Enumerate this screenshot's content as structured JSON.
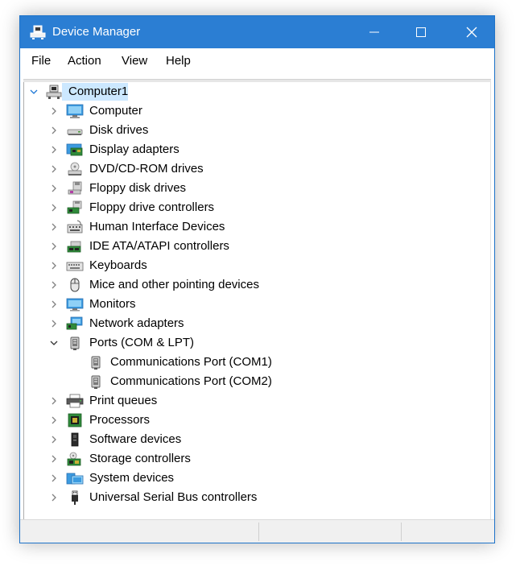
{
  "window": {
    "title": "Device Manager"
  },
  "menu": {
    "items": [
      "File",
      "Action",
      "View",
      "Help"
    ]
  },
  "tree": {
    "root": {
      "label": "Computer1",
      "expanded": true,
      "icon": "computer-root-icon"
    },
    "nodes": [
      {
        "label": "Computer",
        "icon": "computer-icon",
        "expanded": false
      },
      {
        "label": "Disk drives",
        "icon": "disk-drive-icon",
        "expanded": false
      },
      {
        "label": "Display adapters",
        "icon": "display-adapter-icon",
        "expanded": false
      },
      {
        "label": "DVD/CD-ROM drives",
        "icon": "dvd-drive-icon",
        "expanded": false
      },
      {
        "label": "Floppy disk drives",
        "icon": "floppy-disk-icon",
        "expanded": false
      },
      {
        "label": "Floppy drive controllers",
        "icon": "floppy-controller-icon",
        "expanded": false
      },
      {
        "label": "Human Interface Devices",
        "icon": "hid-icon",
        "expanded": false
      },
      {
        "label": "IDE ATA/ATAPI controllers",
        "icon": "ide-controller-icon",
        "expanded": false
      },
      {
        "label": "Keyboards",
        "icon": "keyboard-icon",
        "expanded": false
      },
      {
        "label": "Mice and other pointing devices",
        "icon": "mouse-icon",
        "expanded": false
      },
      {
        "label": "Monitors",
        "icon": "monitor-icon",
        "expanded": false
      },
      {
        "label": "Network adapters",
        "icon": "network-adapter-icon",
        "expanded": false
      },
      {
        "label": "Ports (COM & LPT)",
        "icon": "port-icon",
        "expanded": true,
        "children": [
          {
            "label": "Communications Port (COM1)",
            "icon": "port-icon"
          },
          {
            "label": "Communications Port (COM2)",
            "icon": "port-icon"
          }
        ]
      },
      {
        "label": "Print queues",
        "icon": "printer-icon",
        "expanded": false
      },
      {
        "label": "Processors",
        "icon": "processor-icon",
        "expanded": false
      },
      {
        "label": "Software devices",
        "icon": "software-device-icon",
        "expanded": false
      },
      {
        "label": "Storage controllers",
        "icon": "storage-controller-icon",
        "expanded": false
      },
      {
        "label": "System devices",
        "icon": "system-device-icon",
        "expanded": false
      },
      {
        "label": "Universal Serial Bus controllers",
        "icon": "usb-icon",
        "expanded": false
      }
    ]
  },
  "colors": {
    "titlebar": "#2b7ed3",
    "selection": "#cce8ff",
    "expand_arrow_open": "#1e78d6",
    "collapse_arrow": "#808080"
  }
}
